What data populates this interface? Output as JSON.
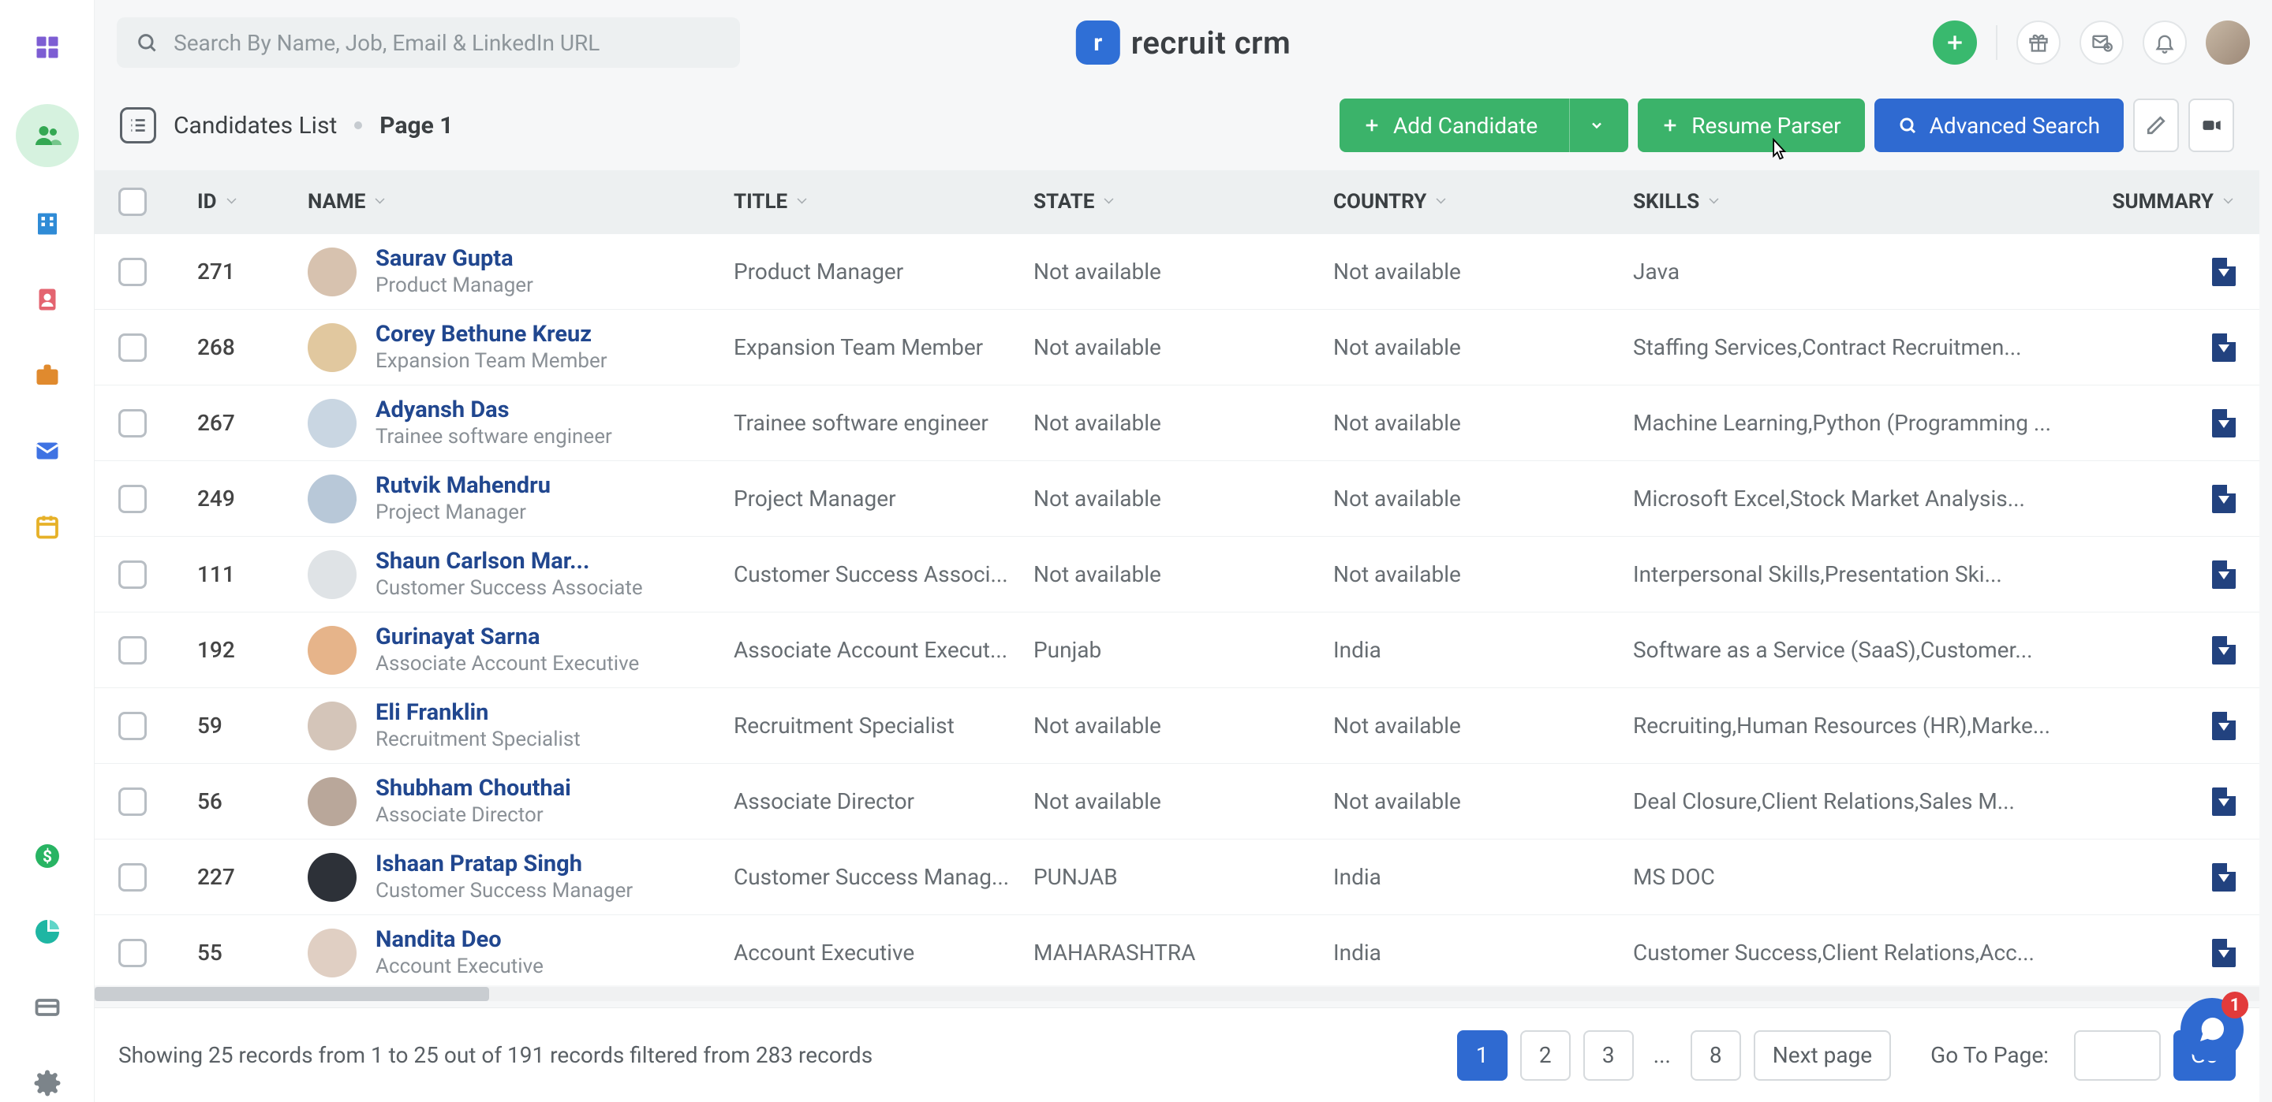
{
  "brand": {
    "name": "recruit crm",
    "logo_letter": "r"
  },
  "search": {
    "placeholder": "Search By Name, Job, Email & LinkedIn URL"
  },
  "topright": {
    "add": "+",
    "gift": "gift",
    "mail": "mail",
    "bell": "bell"
  },
  "sidebar": {
    "items": [
      {
        "icon": "dashboard-icon",
        "color": "#7d5dd3"
      },
      {
        "icon": "candidates-icon",
        "color": "#34a853",
        "active": true
      },
      {
        "icon": "companies-icon",
        "color": "#2f8bd6"
      },
      {
        "icon": "contacts-icon",
        "color": "#e46470"
      },
      {
        "icon": "jobs-icon",
        "color": "#e08a2e"
      },
      {
        "icon": "mail-icon",
        "color": "#3f73e3"
      },
      {
        "icon": "calendar-icon",
        "color": "#e6b128"
      },
      {
        "icon": "deals-icon",
        "color": "#28b463"
      },
      {
        "icon": "reports-icon",
        "color": "#1fb6a3"
      },
      {
        "icon": "billing-icon",
        "color": "#7c848a"
      },
      {
        "icon": "settings-icon",
        "color": "#7c848a"
      }
    ]
  },
  "actionbar": {
    "list_label": "Candidates List",
    "page_label": "Page 1",
    "add_candidate": "Add Candidate",
    "resume_parser": "Resume Parser",
    "advanced_search": "Advanced Search"
  },
  "table": {
    "headers": {
      "id": "ID",
      "name": "NAME",
      "title": "TITLE",
      "state": "STATE",
      "country": "COUNTRY",
      "skills": "SKILLS",
      "summary": "SUMMARY"
    },
    "rows": [
      {
        "id": "271",
        "name": "Saurav Gupta",
        "sub": "Product Manager",
        "title": "Product Manager",
        "state": "Not available",
        "country": "Not available",
        "skills": "Java"
      },
      {
        "id": "268",
        "name": "Corey Bethune Kreuz",
        "sub": "Expansion Team Member",
        "title": "Expansion Team Member",
        "state": "Not available",
        "country": "Not available",
        "skills": "Staffing Services,Contract Recruitmen..."
      },
      {
        "id": "267",
        "name": "Adyansh Das",
        "sub": "Trainee software engineer",
        "title": "Trainee software engineer",
        "state": "Not available",
        "country": "Not available",
        "skills": "Machine Learning,Python (Programming ..."
      },
      {
        "id": "249",
        "name": "Rutvik Mahendru",
        "sub": "Project Manager",
        "title": "Project Manager",
        "state": "Not available",
        "country": "Not available",
        "skills": "Microsoft Excel,Stock Market Analysis..."
      },
      {
        "id": "111",
        "name": "Shaun Carlson Mar...",
        "sub": "Customer Success Associate",
        "title": "Customer Success Associ...",
        "state": "Not available",
        "country": "Not available",
        "skills": "Interpersonal Skills,Presentation Ski..."
      },
      {
        "id": "192",
        "name": "Gurinayat Sarna",
        "sub": "Associate Account Executive",
        "title": "Associate Account Execut...",
        "state": "Punjab",
        "country": "India",
        "skills": "Software as a Service (SaaS),Customer..."
      },
      {
        "id": "59",
        "name": "Eli Franklin",
        "sub": "Recruitment Specialist",
        "title": "Recruitment Specialist",
        "state": "Not available",
        "country": "Not available",
        "skills": "Recruiting,Human Resources (HR),Marke..."
      },
      {
        "id": "56",
        "name": "Shubham Chouthai",
        "sub": "Associate Director",
        "title": "Associate Director",
        "state": "Not available",
        "country": "Not available",
        "skills": "Deal Closure,Client Relations,Sales M..."
      },
      {
        "id": "227",
        "name": "Ishaan Pratap Singh",
        "sub": "Customer Success Manager",
        "title": "Customer Success Manag...",
        "state": "PUNJAB",
        "country": "India",
        "skills": "MS DOC"
      },
      {
        "id": "55",
        "name": "Nandita Deo",
        "sub": "Account Executive",
        "title": "Account Executive",
        "state": "MAHARASHTRA",
        "country": "India",
        "skills": "Customer Success,Client Relations,Acc..."
      }
    ]
  },
  "footer": {
    "showing": "Showing 25 records from 1 to 25 out of 191 records filtered from 283 records",
    "pages": [
      "1",
      "2",
      "3",
      "...",
      "8"
    ],
    "next": "Next page",
    "goto_label": "Go To Page:",
    "go": "Go"
  },
  "chat": {
    "badge": "1"
  }
}
